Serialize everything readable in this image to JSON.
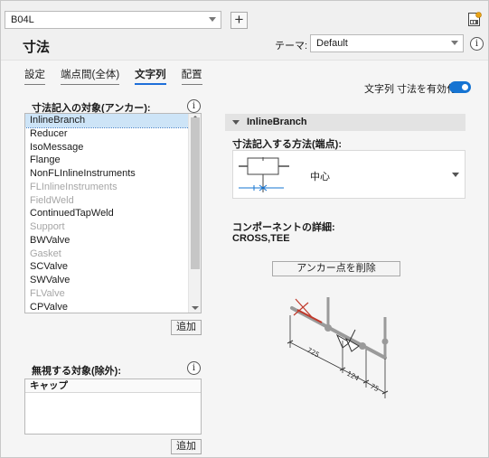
{
  "header": {
    "element_selector": "B04L",
    "add_label": "+",
    "title": "寸法",
    "theme_label": "テーマ:",
    "theme_value": "Default",
    "info_symbol": "i"
  },
  "tabs": [
    {
      "label": "設定",
      "active": false
    },
    {
      "label": "端点間(全体)",
      "active": false
    },
    {
      "label": "文字列",
      "active": true
    },
    {
      "label": "配置",
      "active": false
    }
  ],
  "enable_toggle": {
    "label": "文字列 寸法を有効化:",
    "on": true
  },
  "anchor_targets": {
    "label": "寸法記入の対象(アンカー):",
    "items": [
      {
        "label": "InlineBranch",
        "disabled": false,
        "selected": true
      },
      {
        "label": "Reducer",
        "disabled": false,
        "selected": false
      },
      {
        "label": "IsoMessage",
        "disabled": false,
        "selected": false
      },
      {
        "label": "Flange",
        "disabled": false,
        "selected": false
      },
      {
        "label": "NonFLInlineInstruments",
        "disabled": false,
        "selected": false
      },
      {
        "label": "FLInlineInstruments",
        "disabled": true,
        "selected": false
      },
      {
        "label": "FieldWeld",
        "disabled": true,
        "selected": false
      },
      {
        "label": "ContinuedTapWeld",
        "disabled": false,
        "selected": false
      },
      {
        "label": "Support",
        "disabled": true,
        "selected": false
      },
      {
        "label": "BWValve",
        "disabled": false,
        "selected": false
      },
      {
        "label": "Gasket",
        "disabled": true,
        "selected": false
      },
      {
        "label": "SCValve",
        "disabled": false,
        "selected": false
      },
      {
        "label": "SWValve",
        "disabled": false,
        "selected": false
      },
      {
        "label": "FLValve",
        "disabled": true,
        "selected": false
      },
      {
        "label": "CPValve",
        "disabled": false,
        "selected": false
      }
    ],
    "add_label": "追加"
  },
  "excluded_targets": {
    "label": "無視する対象(除外):",
    "column_header": "キャップ",
    "add_label": "追加"
  },
  "detail": {
    "section_title": "InlineBranch",
    "method_label": "寸法記入する方法(端点):",
    "method_value": "中心",
    "component_detail_label": "コンポーネントの詳細:",
    "component_detail_value": "CROSS,TEE",
    "remove_anchor_label": "アンカー点を削除"
  },
  "diagram": {
    "dimension_labels": [
      "725",
      "124",
      "75"
    ]
  },
  "colors": {
    "accent": "#1674d2",
    "pipe_gray": "#9a9a9a",
    "highlight_red": "#c0392b"
  }
}
